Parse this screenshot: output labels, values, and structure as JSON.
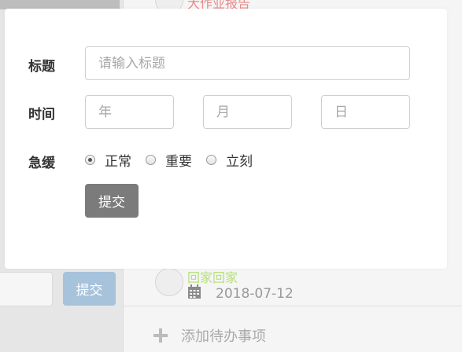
{
  "background": {
    "todo_top_title": "大作业报告",
    "todo_bottom_title": "回家回家",
    "todo_bottom_date": "2018-07-12",
    "add_todo_label": "添加待办事项",
    "left_submit_label": "提交"
  },
  "form": {
    "title_label": "标题",
    "title_placeholder": "请输入标题",
    "time_label": "时间",
    "year_placeholder": "年",
    "month_placeholder": "月",
    "day_placeholder": "日",
    "priority_label": "急缓",
    "priority_options": [
      "正常",
      "重要",
      "立刻"
    ],
    "priority_selected": "正常",
    "submit_label": "提交"
  },
  "colors": {
    "submit_button": "#7b7b7b",
    "left_submit_button": "#a7c3dc",
    "top_title": "#e88a8a",
    "bottom_title": "#b6e07a"
  }
}
